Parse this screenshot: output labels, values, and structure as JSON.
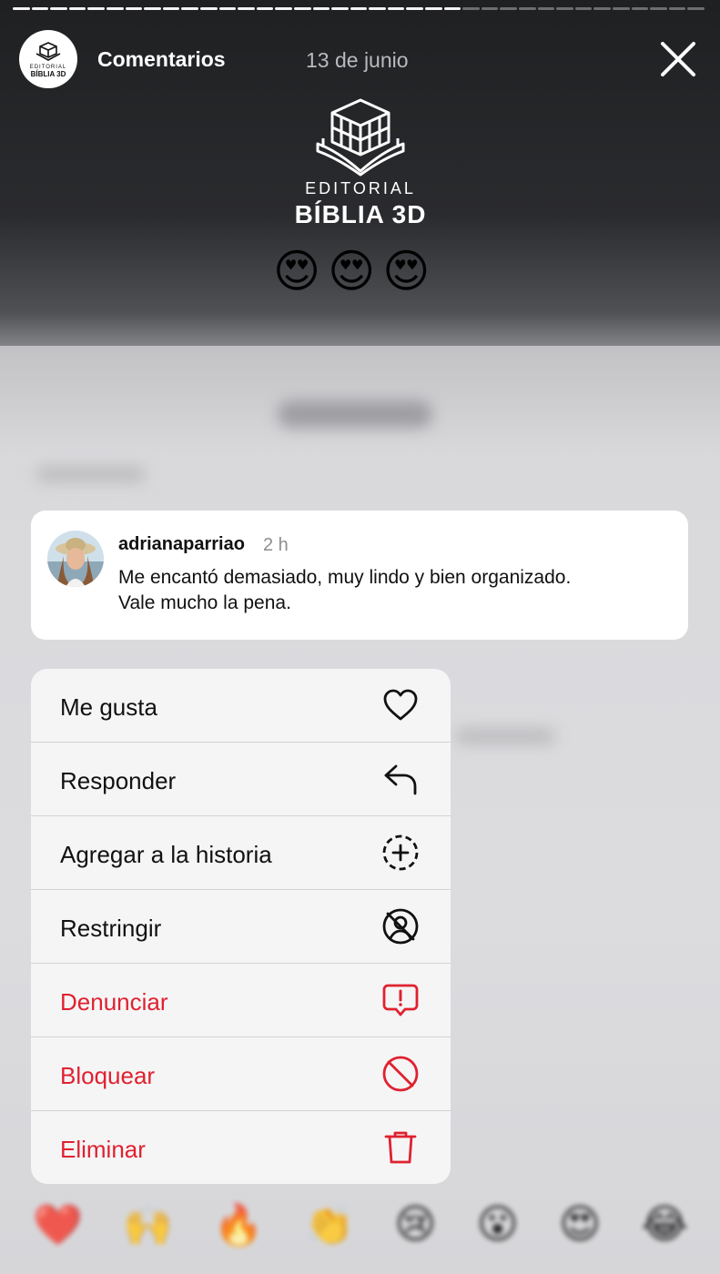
{
  "header": {
    "username": "Comentarios",
    "date": "13 de junio",
    "brand_small": "EDITORIAL",
    "brand_big": "BÍBLIA 3D"
  },
  "story": {
    "logo_small": "EDITORIAL",
    "logo_big": "BÍBLIA 3D",
    "emojis": [
      "😍",
      "😍",
      "😍"
    ]
  },
  "comment": {
    "username": "adrianaparriao",
    "time": "2 h",
    "text_line1": "Me encantó demasiado, muy lindo y bien organizado.",
    "text_line2": "Vale mucho la pena."
  },
  "menu": {
    "items": [
      {
        "label": "Me gusta",
        "icon": "heart-icon",
        "color": "#111111"
      },
      {
        "label": "Responder",
        "icon": "reply-icon",
        "color": "#111111"
      },
      {
        "label": "Agregar a la historia",
        "icon": "add-story-icon",
        "color": "#111111"
      },
      {
        "label": "Restringir",
        "icon": "restrict-icon",
        "color": "#111111"
      },
      {
        "label": "Denunciar",
        "icon": "report-icon",
        "color": "#e0212f"
      },
      {
        "label": "Bloquear",
        "icon": "block-icon",
        "color": "#e0212f"
      },
      {
        "label": "Eliminar",
        "icon": "trash-icon",
        "color": "#e0212f"
      }
    ]
  },
  "reactions": [
    "❤️",
    "🙌",
    "🔥",
    "👏",
    "😢",
    "😮",
    "😍",
    "😂"
  ],
  "colors": {
    "danger": "#e0212f",
    "card": "#ffffff",
    "menu": "#f5f5f6"
  }
}
